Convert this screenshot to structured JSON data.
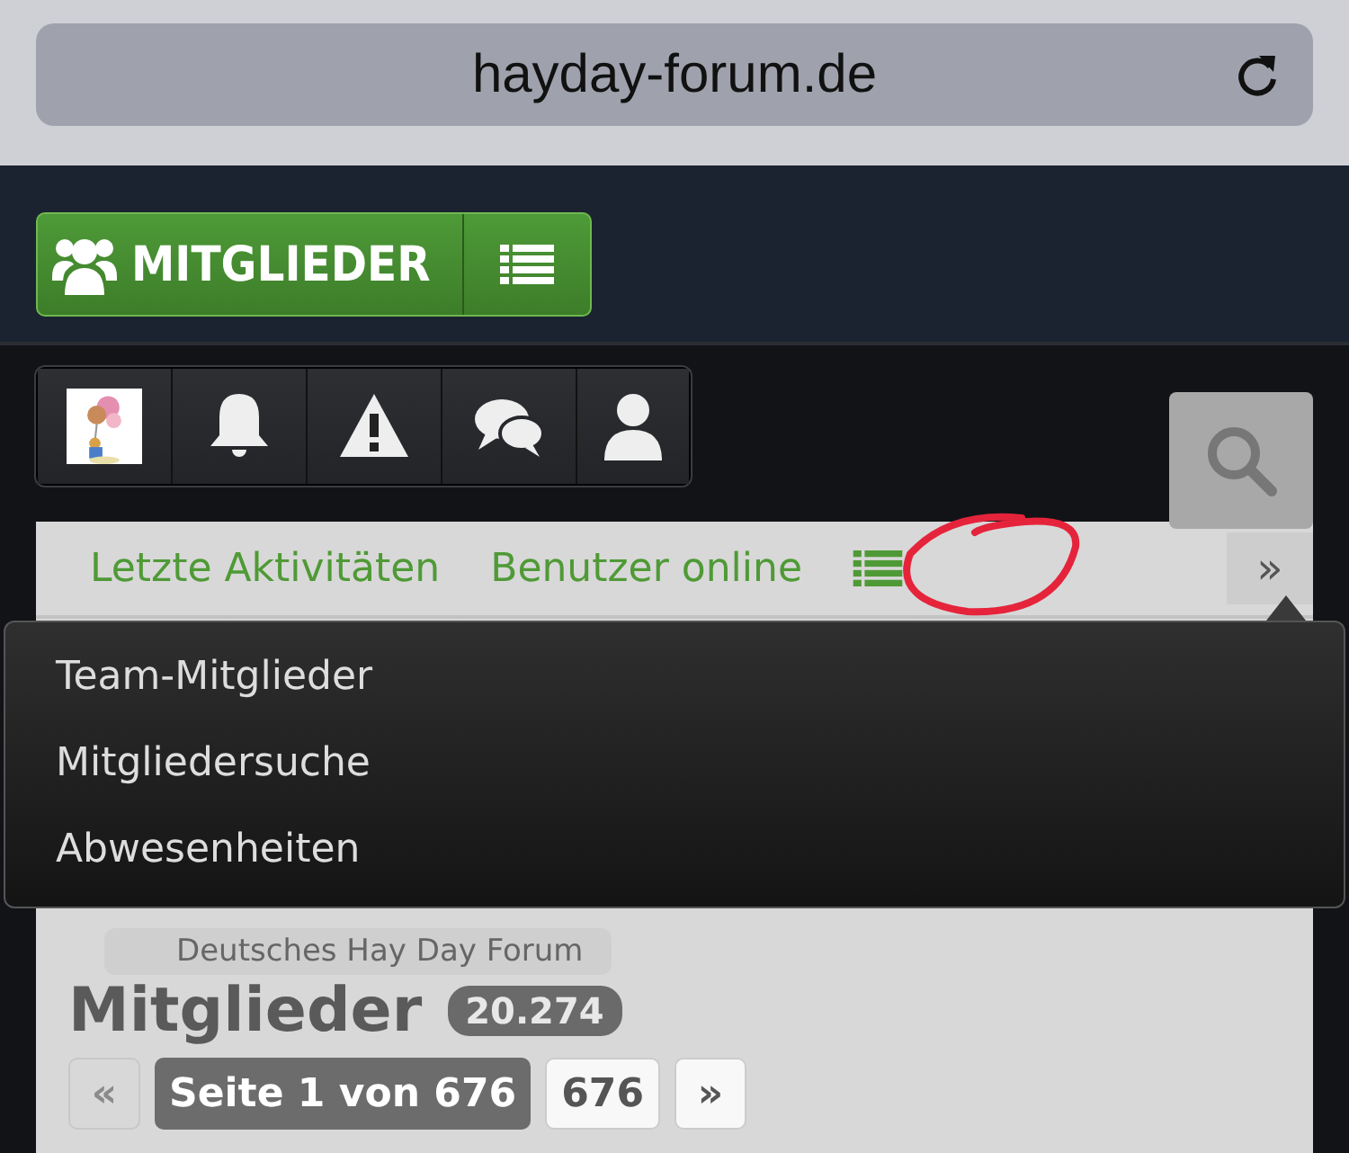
{
  "browser": {
    "url": "hayday-forum.de"
  },
  "section_button": {
    "label": "MITGLIEDER"
  },
  "tabs": [
    {
      "label": "Letzte Aktivitäten"
    },
    {
      "label": "Benutzer online"
    }
  ],
  "scroll_next": "»",
  "menu": {
    "items": [
      "Team-Mitglieder",
      "Mitgliedersuche",
      "Abwesenheiten"
    ]
  },
  "breadcrumb": [
    "Deutsches Hay Day Forum"
  ],
  "heading": {
    "title": "Mitglieder",
    "count": "20.274"
  },
  "pagination": {
    "prev": "«",
    "current": "Seite 1 von 676",
    "pages": [
      "676"
    ],
    "next": "»"
  }
}
